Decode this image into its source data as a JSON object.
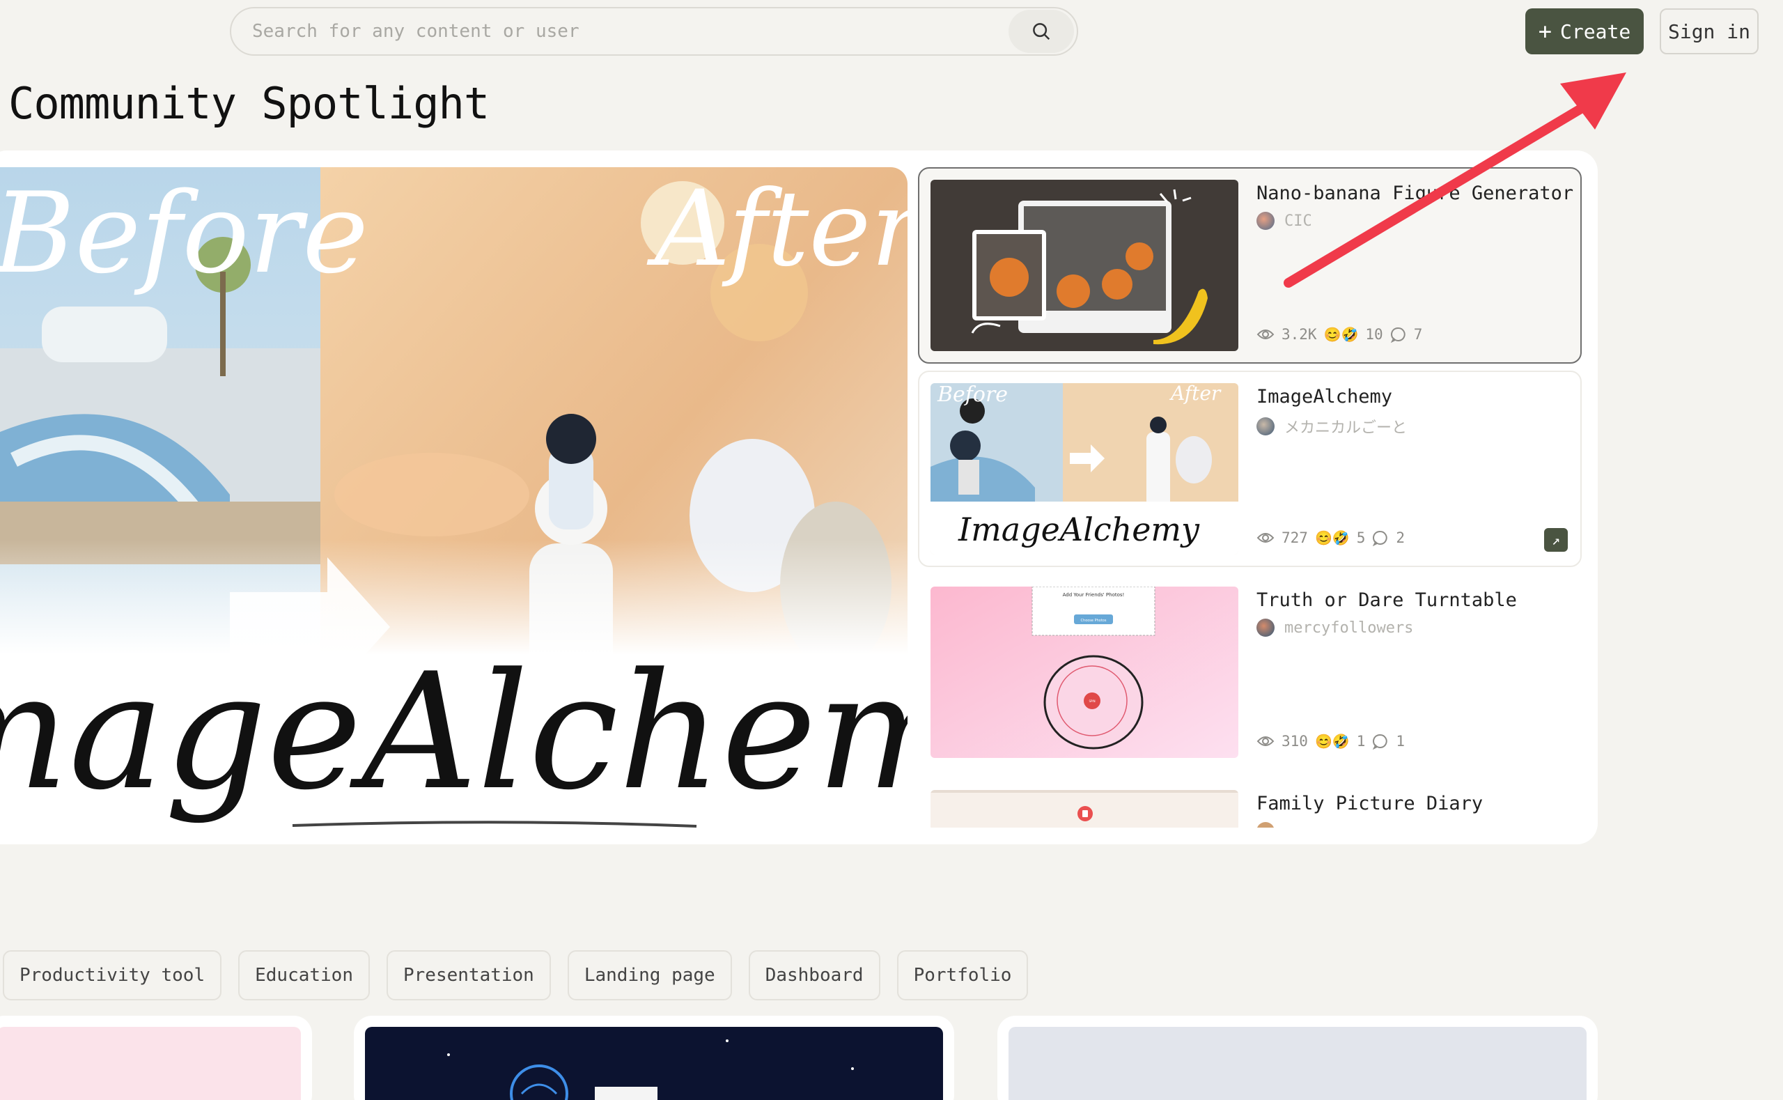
{
  "header": {
    "search_placeholder": "Search for any content or user",
    "create_label": "Create",
    "create_icon": "+",
    "signin_label": "Sign in"
  },
  "page_title": "Community Spotlight",
  "hero": {
    "before_text": "Before",
    "after_text": "After",
    "brand_text": "ImageAlchemy"
  },
  "spotlight": [
    {
      "title": "Nano-banana Figure Generator",
      "author": "CIC",
      "views": "3.2K",
      "reactions": "10",
      "comments": "7",
      "avatar_color": "#c7775b"
    },
    {
      "title": "ImageAlchemy",
      "author": "メカニカルごーと",
      "views": "727",
      "reactions": "5",
      "comments": "2",
      "avatar_color": "#5d7490"
    },
    {
      "title": "Truth or Dare Turntable",
      "author": "mercyfollowers",
      "views": "310",
      "reactions": "1",
      "comments": "1",
      "avatar_color": "#4b6e8a"
    },
    {
      "title": "Family Picture Diary",
      "author": "",
      "views": "",
      "reactions": "",
      "comments": "",
      "avatar_color": "#d0a072"
    }
  ],
  "tags": [
    "Productivity tool",
    "Education",
    "Presentation",
    "Landing page",
    "Dashboard",
    "Portfolio"
  ],
  "bottom_cards": [
    {
      "thumb_color": "#fbe3ea"
    },
    {
      "thumb_color": "#0c1330"
    },
    {
      "thumb_color": "#e2e5ec"
    }
  ],
  "thumb_texts": {
    "turntable_heading": "Add Your Friends' Photos!",
    "turntable_btn": "Choose Photos",
    "turntable_center": "SPIN"
  },
  "colors": {
    "accent": "#4a5441",
    "annotation_arrow": "#f03a4a"
  }
}
